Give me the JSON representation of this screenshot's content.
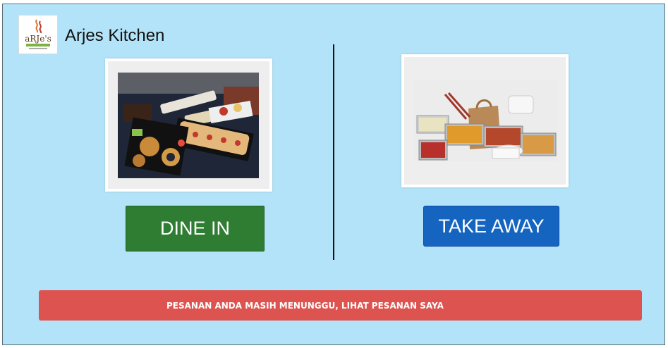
{
  "header": {
    "logo_text": "aRJe's",
    "title": "Arjes Kitchen"
  },
  "options": {
    "dine_in_label": "DINE IN",
    "take_away_label": "TAKE AWAY"
  },
  "banner": {
    "text": "PESANAN ANDA MASIH MENUNGGU, LIHAT PESANAN SAYA"
  },
  "colors": {
    "background": "#b3e3f8",
    "dine_in_button": "#2e7d32",
    "take_away_button": "#1565c0",
    "banner": "#dc5350"
  }
}
